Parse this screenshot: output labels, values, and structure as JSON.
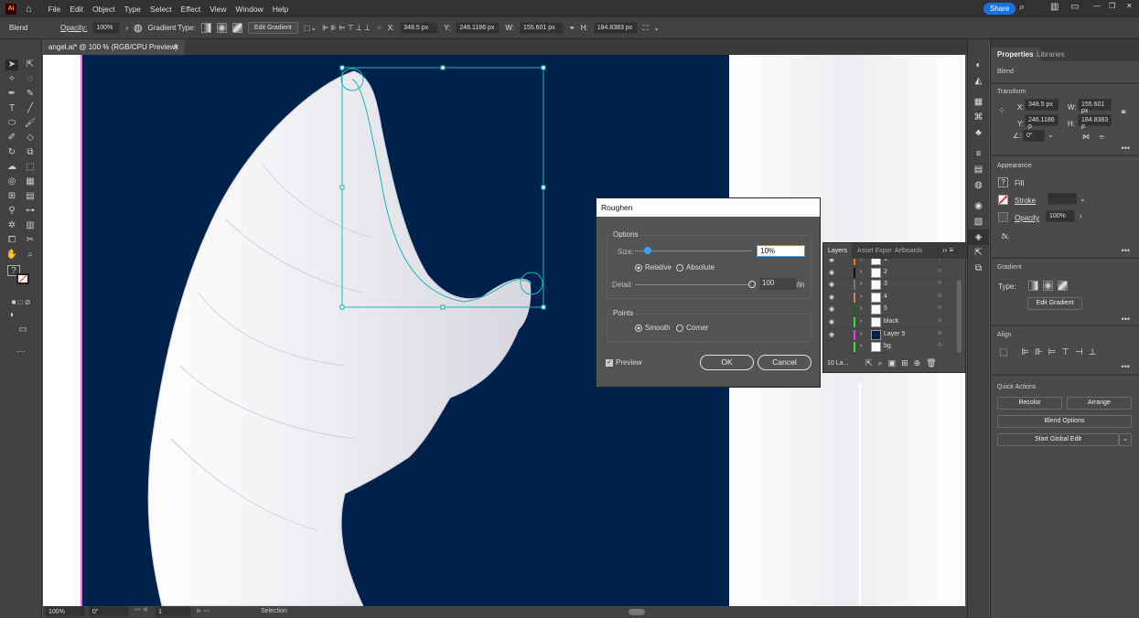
{
  "app": {
    "logo": "Ai",
    "menu": [
      "File",
      "Edit",
      "Object",
      "Type",
      "Select",
      "Effect",
      "View",
      "Window",
      "Help"
    ],
    "share": "Share"
  },
  "control": {
    "object_type": "Blend",
    "opacity_label": "Opacity:",
    "opacity": "100%",
    "gradient_type_label": "Gradient Type:",
    "edit_gradient": "Edit Gradient",
    "x_label": "X:",
    "x": "348.5 px",
    "y_label": "Y:",
    "y": "246.1186 px",
    "w_label": "W:",
    "w": "155.601 px",
    "h_label": "H:",
    "h": "184.8383 px"
  },
  "document": {
    "tab": "angel.ai* @ 100 % (RGB/CPU Preview)"
  },
  "colors": {
    "artboard_bg": "#00214a",
    "accent": "#1473e6",
    "selection": "#1fb5b5"
  },
  "status": {
    "zoom": "100%",
    "rotation": "0°",
    "artboard": "1",
    "tool": "Selection"
  },
  "properties": {
    "tabs": [
      "Properties",
      "Libraries"
    ],
    "object": "Blend",
    "transform": {
      "title": "Transform",
      "x_label": "X:",
      "x": "348.5 px",
      "y_label": "Y:",
      "y": "246.1186 p",
      "w_label": "W:",
      "w": "155.601 px",
      "h_label": "H:",
      "h": "184.8383 p",
      "angle": "0°"
    },
    "appearance": {
      "title": "Appearance",
      "fill": "Fill",
      "stroke": "Stroke",
      "opacity_label": "Opacity",
      "opacity": "100%",
      "fx": "fx."
    },
    "gradient": {
      "title": "Gradient",
      "type_label": "Type:",
      "edit": "Edit Gradient"
    },
    "align": {
      "title": "Align"
    },
    "quick_actions": {
      "title": "Quick Actions",
      "recolor": "Recolor",
      "arrange": "Arrange",
      "blend_options": "Blend Options",
      "global_edit": "Start Global Edit"
    }
  },
  "roughen": {
    "title": "Roughen",
    "options": "Options",
    "size_label": "Size:",
    "size": "10%",
    "size_fraction": 0.1,
    "relative": "Relative",
    "absolute": "Absolute",
    "size_mode": "Relative",
    "detail_label": "Detail:",
    "detail": "100",
    "detail_unit": "/in",
    "detail_fraction": 1.0,
    "points": "Points",
    "smooth": "Smooth",
    "corner": "Corner",
    "points_mode": "Smooth",
    "preview": "Preview",
    "preview_checked": true,
    "ok": "OK",
    "cancel": "Cancel"
  },
  "layers": {
    "tabs": [
      "Layers",
      "Asset Expor",
      "Artboards"
    ],
    "count": "10 La...",
    "rows": [
      {
        "name": "1",
        "color": "#ff6a00",
        "visible": true
      },
      {
        "name": "2",
        "color": "#111111",
        "visible": true
      },
      {
        "name": "3",
        "color": "#777777",
        "visible": true
      },
      {
        "name": "4",
        "color": "#c8895a",
        "visible": true
      },
      {
        "name": "5",
        "color": "#106a10",
        "visible": true
      },
      {
        "name": "black",
        "color": "#33dd33",
        "visible": true
      },
      {
        "name": "Layer 5",
        "color": "#ee33ee",
        "visible": true
      },
      {
        "name": "bg",
        "color": "#33dd33",
        "visible": false
      }
    ]
  }
}
